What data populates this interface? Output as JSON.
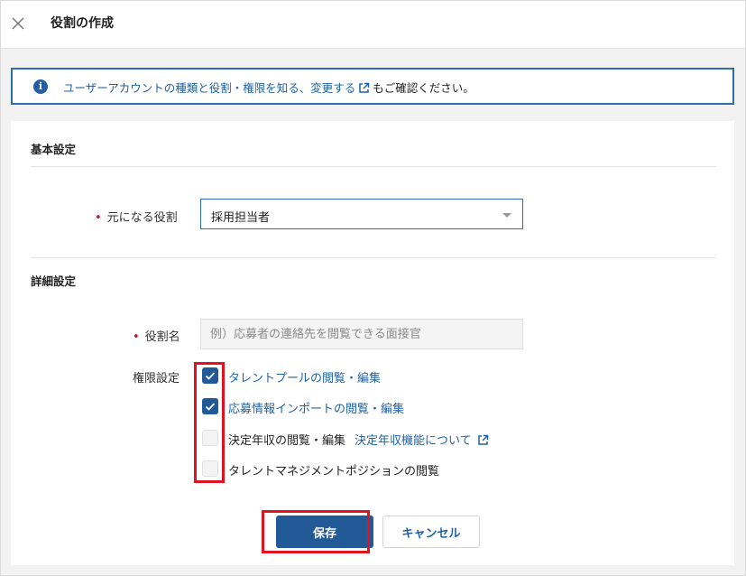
{
  "header": {
    "title": "役割の作成",
    "close_icon": "close-icon"
  },
  "notice": {
    "icon": "info-icon",
    "link_text": "ユーザーアカウントの種類と役割・権限を知る、変更する",
    "suffix": "もご確認ください。"
  },
  "basic": {
    "section_title": "基本設定",
    "base_role_label": "元になる役割",
    "base_role_value": "採用担当者"
  },
  "detail": {
    "section_title": "詳細設定",
    "role_name_label": "役割名",
    "role_name_value": "",
    "role_name_placeholder": "例）応募者の連絡先を閲覧できる面接官",
    "permissions_label": "権限設定",
    "permissions": [
      {
        "label": "タレントプールの閲覧・編集",
        "checked": true
      },
      {
        "label": "応募情報インポートの閲覧・編集",
        "checked": true
      },
      {
        "label": "決定年収の閲覧・編集",
        "checked": false,
        "link": "決定年収機能について"
      },
      {
        "label": "タレントマネジメントポジションの閲覧",
        "checked": false
      }
    ]
  },
  "actions": {
    "save_label": "保存",
    "cancel_label": "キャンセル"
  },
  "colors": {
    "accent": "#215a96",
    "link": "#1f63a6",
    "required": "#c8102e",
    "highlight": "#e0141e"
  }
}
